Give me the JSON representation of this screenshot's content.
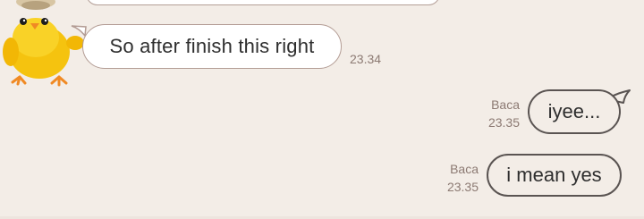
{
  "messages": [
    {
      "direction": "incoming",
      "text": "So after finish this right",
      "time": "23.34",
      "status": ""
    },
    {
      "direction": "outgoing",
      "text": "iyee...",
      "time": "23.35",
      "status": "Baca"
    },
    {
      "direction": "outgoing",
      "text": "i mean yes",
      "time": "23.35",
      "status": "Baca"
    }
  ],
  "colors": {
    "background": "#f3ede7",
    "incoming_bubble": "#ffffff",
    "incoming_border": "#b39c94",
    "outgoing_border": "#5a5452",
    "meta_text": "#8c7a73"
  },
  "icons": {
    "avatar": "yellow-chick-sticker-icon"
  }
}
